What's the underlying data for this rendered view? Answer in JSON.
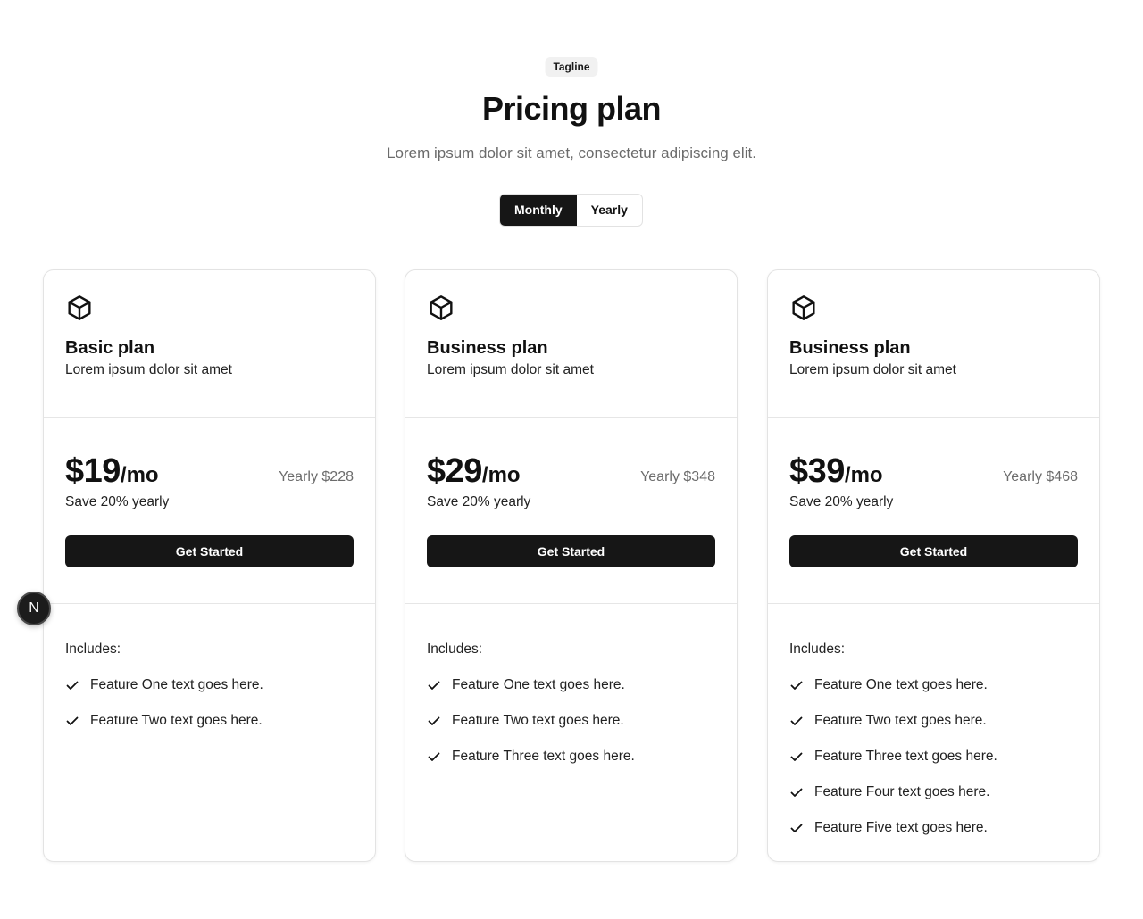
{
  "header": {
    "tagline": "Tagline",
    "title": "Pricing plan",
    "subtitle": "Lorem ipsum dolor sit amet, consectetur adipiscing elit."
  },
  "billing_toggle": {
    "options": [
      "Monthly",
      "Yearly"
    ],
    "selected": "Monthly"
  },
  "plans": [
    {
      "icon": "cube-icon",
      "name": "Basic plan",
      "description": "Lorem ipsum dolor sit amet",
      "price": "$19",
      "period": "/mo",
      "yearly": "Yearly $228",
      "save": "Save 20% yearly",
      "cta": "Get Started",
      "includes_label": "Includes:",
      "features": [
        "Feature One text goes here.",
        "Feature Two text goes here."
      ]
    },
    {
      "icon": "cube-icon",
      "name": "Business plan",
      "description": "Lorem ipsum dolor sit amet",
      "price": "$29",
      "period": "/mo",
      "yearly": "Yearly $348",
      "save": "Save 20% yearly",
      "cta": "Get Started",
      "includes_label": "Includes:",
      "features": [
        "Feature One text goes here.",
        "Feature Two text goes here.",
        "Feature Three text goes here."
      ]
    },
    {
      "icon": "cube-icon",
      "name": "Business plan",
      "description": "Lorem ipsum dolor sit amet",
      "price": "$39",
      "period": "/mo",
      "yearly": "Yearly $468",
      "save": "Save 20% yearly",
      "cta": "Get Started",
      "includes_label": "Includes:",
      "features": [
        "Feature One text goes here.",
        "Feature Two text goes here.",
        "Feature Three text goes here.",
        "Feature Four text goes here.",
        "Feature Five text goes here."
      ]
    }
  ],
  "dev_badge": {
    "label": "N",
    "icon": "nextjs-icon"
  },
  "colors": {
    "primary": "#161616",
    "muted": "#6b6b6b",
    "border": "#e3e3e3",
    "tag_bg": "#f1f1f1"
  }
}
